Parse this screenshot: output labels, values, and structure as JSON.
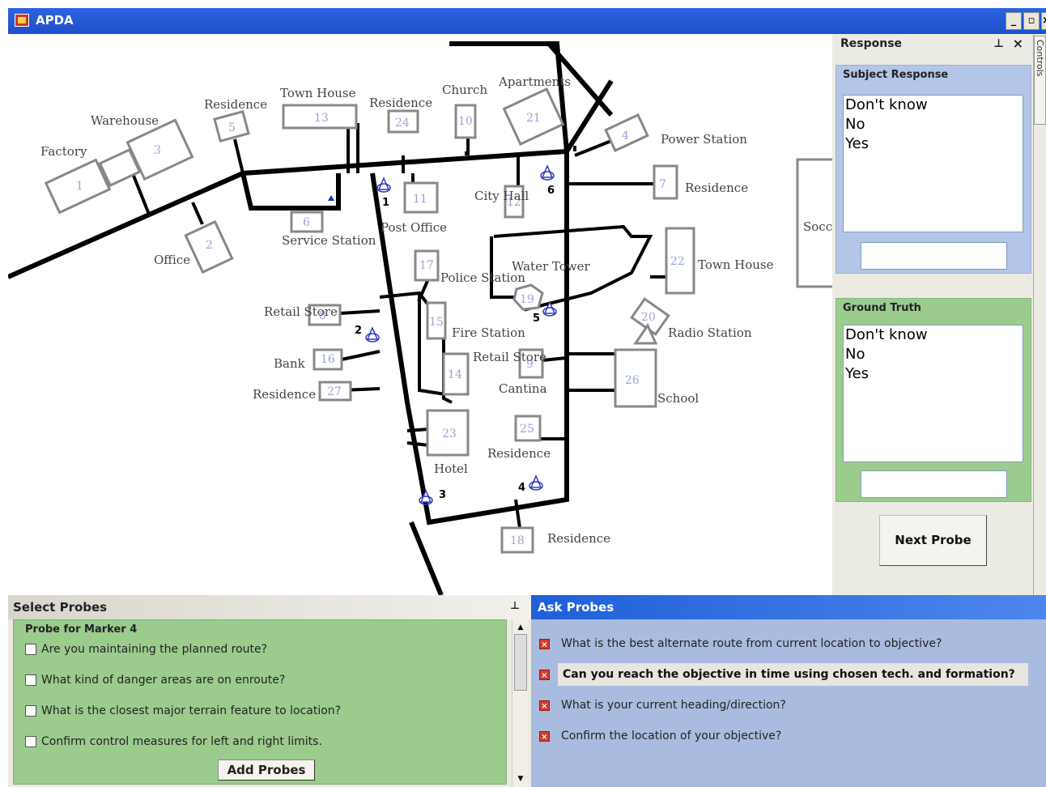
{
  "window": {
    "title": "APDA"
  },
  "map": {
    "labels": {
      "factory": "Factory",
      "warehouse": "Warehouse",
      "residence_a": "Residence",
      "town_house_a": "Town House",
      "residence_b": "Residence",
      "church": "Church",
      "apartments": "Apartments",
      "power_station": "Power Station",
      "residence_c": "Residence",
      "office": "Office",
      "service_station": "Service Station",
      "post_office": "Post Office",
      "city_hall": "City Hall",
      "water_tower": "Water Tower",
      "town_house_b": "Town House",
      "police_station": "Police Station",
      "retail_store_a": "Retail Store",
      "fire_station": "Fire Station",
      "radio_station": "Radio Station",
      "bank": "Bank",
      "retail_store_b": "Retail Store",
      "cantina": "Cantina",
      "school": "School",
      "residence_d": "Residence",
      "residence_e": "Residence",
      "hotel": "Hotel",
      "residence_f": "Residence",
      "soccer_field": "Socc Field"
    },
    "building_numbers": [
      "1",
      "2",
      "3",
      "4",
      "5",
      "6",
      "7",
      "8",
      "9",
      "11",
      "12",
      "13",
      "14",
      "15",
      "16",
      "17",
      "18",
      "19",
      "20",
      "21",
      "22",
      "23",
      "24",
      "25",
      "26",
      "27",
      "10"
    ],
    "markers": [
      "1",
      "2",
      "3",
      "4",
      "5",
      "6"
    ]
  },
  "response": {
    "title": "Response",
    "subject_response": {
      "label": "Subject Response",
      "options": [
        "Don't know",
        "No",
        "Yes"
      ]
    },
    "ground_truth": {
      "label": "Ground Truth",
      "options": [
        "Don't know",
        "No",
        "Yes"
      ]
    },
    "next_probe": "Next Probe",
    "side_tab": "Controls"
  },
  "select_probes": {
    "title": "Select Probes",
    "group_label": "Probe for Marker 4",
    "items": [
      "Are you maintaining the planned route?",
      "What kind of danger areas are on enroute?",
      "What is the closest major terrain feature to location?",
      "Confirm control measures for left and right limits."
    ],
    "add_button": "Add Probes"
  },
  "ask_probes": {
    "title": "Ask Probes",
    "items": [
      "What is the best alternate route from current location to objective?",
      "Can you reach the objective in time using chosen tech. and formation?",
      "What is your current heading/direction?",
      "Confirm the location of your objective?"
    ]
  }
}
